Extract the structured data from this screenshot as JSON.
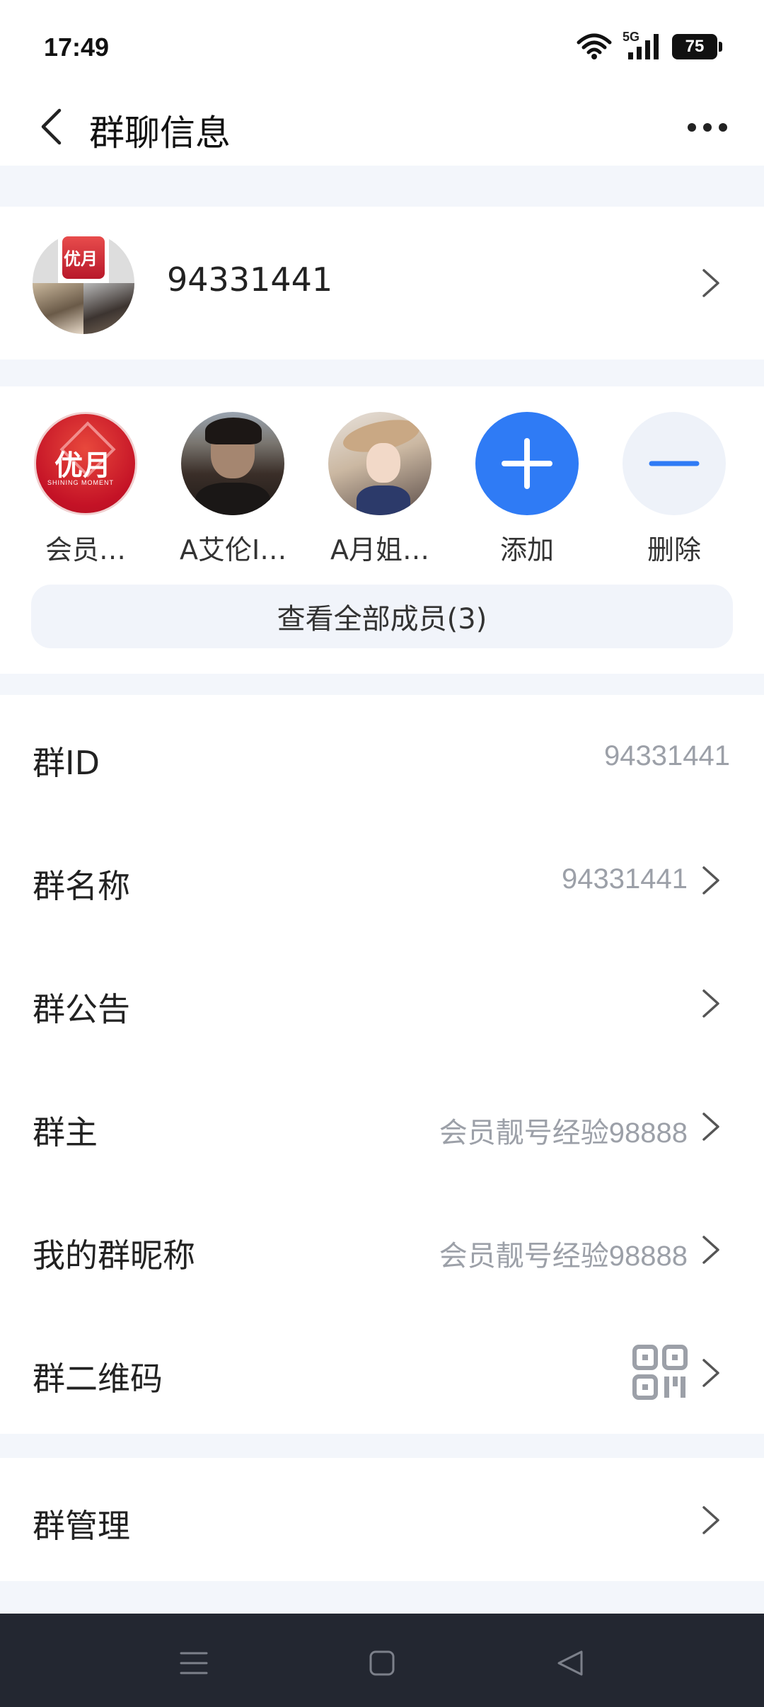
{
  "status_bar": {
    "time": "17:49",
    "network": "5G",
    "battery": "75"
  },
  "nav": {
    "title": "群聊信息"
  },
  "group": {
    "name": "94331441"
  },
  "members": [
    {
      "name": "会员…",
      "avatar": "youyue-logo-avatar"
    },
    {
      "name": "A艾伦I…",
      "avatar": "anime-man-avatar"
    },
    {
      "name": "A月姐…",
      "avatar": "girl-hat-avatar"
    },
    {
      "name": "添加",
      "avatar": "plus-icon"
    },
    {
      "name": "删除",
      "avatar": "minus-icon"
    }
  ],
  "view_all_label": "查看全部成员(3)",
  "settings": [
    {
      "label": "群ID",
      "value": "94331441"
    },
    {
      "label": "群名称",
      "value": "94331441"
    },
    {
      "label": "群公告",
      "value": ""
    },
    {
      "label": "群主",
      "value": "会员靓号经验98888"
    },
    {
      "label": "我的群昵称",
      "value": "会员靓号经验98888"
    },
    {
      "label": "群二维码",
      "value": "qr-code-icon"
    }
  ],
  "manage": {
    "label": "群管理"
  },
  "logo_text": {
    "main": "优月",
    "sub": "SHINING MOMENT"
  },
  "colors": {
    "accent": "#2f7bf5",
    "background": "#f3f6fb",
    "bottom_nav": "#232731"
  }
}
